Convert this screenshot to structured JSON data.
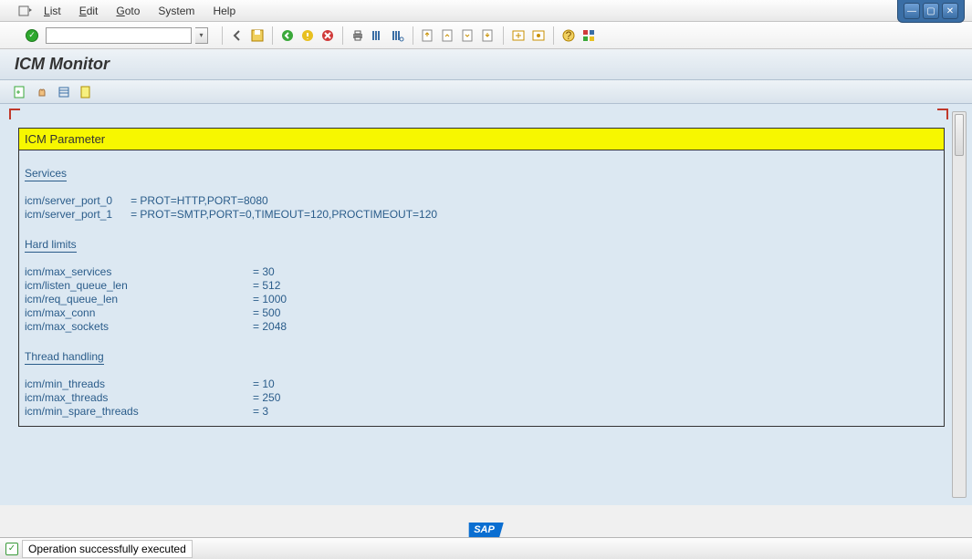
{
  "menu": {
    "list": "List",
    "edit": "Edit",
    "goto": "Goto",
    "system": "System",
    "help": "Help"
  },
  "title": "ICM Monitor",
  "report": {
    "header": "ICM Parameter",
    "sections": {
      "services": {
        "title": "Services",
        "rows": [
          {
            "key": "icm/server_port_0",
            "eq": "=",
            "val": "PROT=HTTP,PORT=8080"
          },
          {
            "key": "icm/server_port_1",
            "eq": "=",
            "val": "PROT=SMTP,PORT=0,TIMEOUT=120,PROCTIMEOUT=120"
          }
        ]
      },
      "hardlimits": {
        "title": "Hard limits",
        "rows": [
          {
            "key": "icm/max_services",
            "eq": "=",
            "val": "30"
          },
          {
            "key": "icm/listen_queue_len",
            "eq": "=",
            "val": "512"
          },
          {
            "key": "icm/req_queue_len",
            "eq": "=",
            "val": "1000"
          },
          {
            "key": "icm/max_conn",
            "eq": "=",
            "val": "500"
          },
          {
            "key": "icm/max_sockets",
            "eq": "=",
            "val": "2048"
          }
        ]
      },
      "threads": {
        "title": "Thread handling",
        "rows": [
          {
            "key": "icm/min_threads",
            "eq": "=",
            "val": "10"
          },
          {
            "key": "icm/max_threads",
            "eq": "=",
            "val": "250"
          },
          {
            "key": "icm/min_spare_threads",
            "eq": "=",
            "val": "3"
          }
        ]
      }
    }
  },
  "status": {
    "text": "Operation successfully executed"
  },
  "logo": "SAP"
}
